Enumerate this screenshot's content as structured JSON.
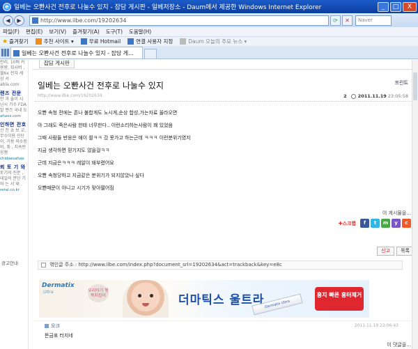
{
  "window": {
    "title": "일베는 오뽠사건 전후로 나눌수 있지 - 잡담 게시판 - 일베저장소 - Daum에서 제공한 Windows Internet Explorer",
    "minimize": "_",
    "maximize": "□",
    "close": "X"
  },
  "address": {
    "url": "http://www.ilbe.com/19202634",
    "back": "◀",
    "forward": "▶",
    "search_placeholder": "Naver"
  },
  "menu": [
    "파일(F)",
    "편집(E)",
    "보기(V)",
    "즐겨찾기(A)",
    "도구(T)",
    "도움말(H)"
  ],
  "favorites": {
    "label": "즐겨찾기",
    "items": [
      "추천 사이트 ▾",
      "무료 Hotmail",
      "연결 사용자 지정",
      "Daum 오늘의 주요 뉴스 ▾"
    ]
  },
  "tab": {
    "label": "일베는 오뽠사건 전후로 나눌수 있지 - 잡담 게..."
  },
  "sidebar": {
    "blocks": [
      {
        "text": "란리, 10배 커 용량, 회사버 , 월6x 전자 세 상 서 abla.com",
        "title": "",
        "url": ""
      },
      {
        "title": "렌즈 전문",
        "text": "안 과 술이 시 닌시 기수 FDA 발 렌즈 국내 도",
        "url": "ahaxs.com"
      },
      {
        "title": "인하면 전호",
        "text": "신 잔 쇼 보 교, 무수이용 진단이, 거용 와수장비, 취 , 지속반응행",
        "url": "chidaesahae"
      },
      {
        "title": "뢰 토 기 와",
        "text": "토기의 진문 , 데일의 분단 기와 는 서 재 .",
        "url": "reral.co.kr"
      }
    ],
    "ad_label": "광고안내"
  },
  "post": {
    "board": "잡담 게시판",
    "print": "프린트",
    "title": "일베는 오뽠사건 전후로 나눌수 있지",
    "url": "http://www.ilbe.com/19202634",
    "comment_count": "2",
    "date": "2011.11.19",
    "time": "23:05:58",
    "lines": [
      "오뽠 속청 전에는 존나 불합게도 노시게,순상 합성,가는자료 올라오면",
      "",
      "아 그래도 죽은사람 한테 너무한다.. 이런소리하는사람이 꽤 있었음",
      "",
      "그때 사람들 반응은 에이 씔ㅋㅋ 갔 못가고 하는근데 ㅋㅋㅋ 이런분위기였지",
      "",
      "지금 생각하면 믿기지도 않을걸ㅋㅋ",
      "",
      "근데 지금은ㅋㅋㅋ 레알이 돼부렸어요",
      "",
      "오뽠 속청당하고 지금같은 분위기가 되지않았나 싶다",
      "",
      "오뽠때문이 아니고 시기가 맞아떨어짐"
    ],
    "more_posts": "이 게시물을...",
    "scrap_label": "스크랩",
    "sns": [
      {
        "name": "facebook",
        "glyph": "f",
        "color": "#3b5998"
      },
      {
        "name": "twitter",
        "glyph": "t",
        "color": "#33b5e6"
      },
      {
        "name": "me2day",
        "glyph": "m",
        "color": "#48a845"
      },
      {
        "name": "yozm",
        "glyph": "y",
        "color": "#7a55c4"
      },
      {
        "name": "cyworld",
        "glyph": "c",
        "color": "#f05a28"
      }
    ],
    "report_button": "신고",
    "list_button": "목록",
    "trackback": "엮인글 주소 : http://www.ilbe.com/index.php?document_srl=19202634&act=trackback&key=e8c"
  },
  "banner": {
    "logo": "Dermatix",
    "logo_sub": "Ultra",
    "cloud_text": "우리아기 행복지킴이",
    "headline": "더마틱스 울트라",
    "tube_text": "Dermatix Ultra",
    "cta": "흉지 빠른 흉터제거",
    "colors": {
      "cta": "#e0262f",
      "headline": "#1d4fa3"
    }
  },
  "comment": {
    "user": "오크",
    "date": "2011.11.19 23:06:43",
    "text": "뜬금포 터지네",
    "more": "이 댓글을..."
  }
}
